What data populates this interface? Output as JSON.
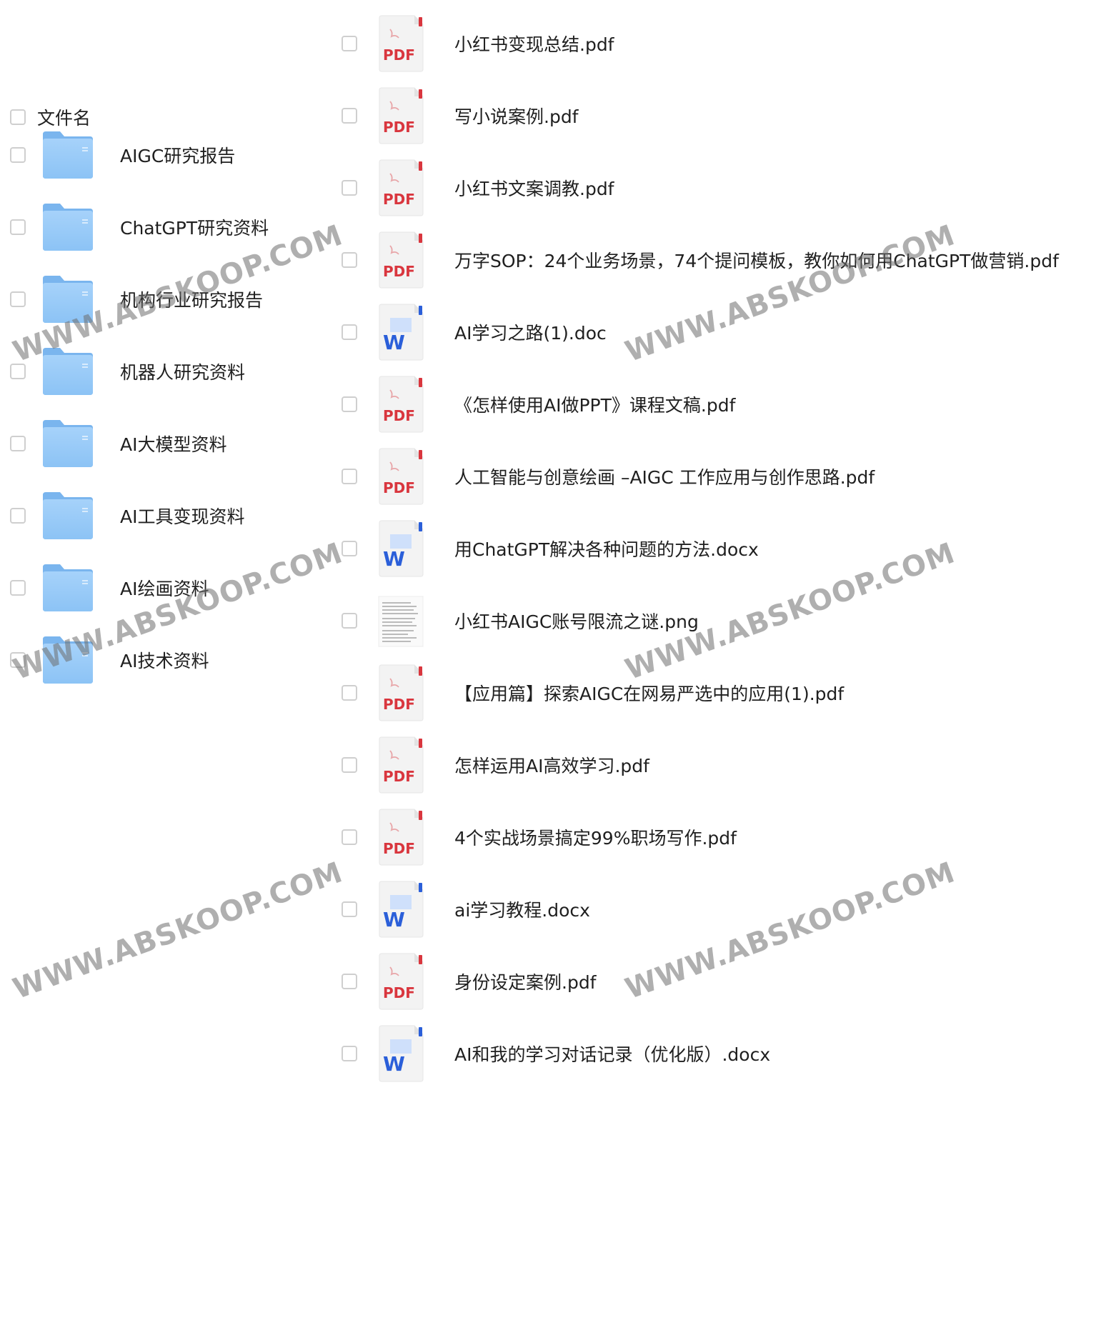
{
  "header": {
    "column_label": "文件名"
  },
  "folders": [
    {
      "name": "AIGC研究报告"
    },
    {
      "name": "ChatGPT研究资料"
    },
    {
      "name": "机构行业研究报告"
    },
    {
      "name": "机器人研究资料"
    },
    {
      "name": "AI大模型资料"
    },
    {
      "name": "AI工具变现资料"
    },
    {
      "name": "AI绘画资料"
    },
    {
      "name": "AI技术资料"
    }
  ],
  "files": [
    {
      "name": "小红书变现总结.pdf",
      "type": "pdf"
    },
    {
      "name": "写小说案例.pdf",
      "type": "pdf"
    },
    {
      "name": "小红书文案调教.pdf",
      "type": "pdf"
    },
    {
      "name": "万字SOP：24个业务场景，74个提问模板，教你如何用ChatGPT做营销.pdf",
      "type": "pdf"
    },
    {
      "name": "AI学习之路(1).doc",
      "type": "word"
    },
    {
      "name": "《怎样使用AI做PPT》课程文稿.pdf",
      "type": "pdf"
    },
    {
      "name": "人工智能与创意绘画 –AIGC 工作应用与创作思路.pdf",
      "type": "pdf"
    },
    {
      "name": "用ChatGPT解决各种问题的方法.docx",
      "type": "word"
    },
    {
      "name": "小红书AIGC账号限流之谜.png",
      "type": "image"
    },
    {
      "name": "【应用篇】探索AIGC在网易严选中的应用(1).pdf",
      "type": "pdf"
    },
    {
      "name": "怎样运用AI高效学习.pdf",
      "type": "pdf"
    },
    {
      "name": "4个实战场景搞定99%职场写作.pdf",
      "type": "pdf"
    },
    {
      "name": "ai学习教程.docx",
      "type": "word"
    },
    {
      "name": "身份设定案例.pdf",
      "type": "pdf"
    },
    {
      "name": "AI和我的学习对话记录（优化版）.docx",
      "type": "word"
    }
  ],
  "icons": {
    "pdf_label": "PDF",
    "word_label": "W"
  },
  "colors": {
    "pdf_red": "#d9363e",
    "word_blue": "#2b5fd9",
    "folder_blue": "#8cc3f5"
  },
  "watermark": {
    "text": "WWW.ABSKOOP.COM"
  }
}
